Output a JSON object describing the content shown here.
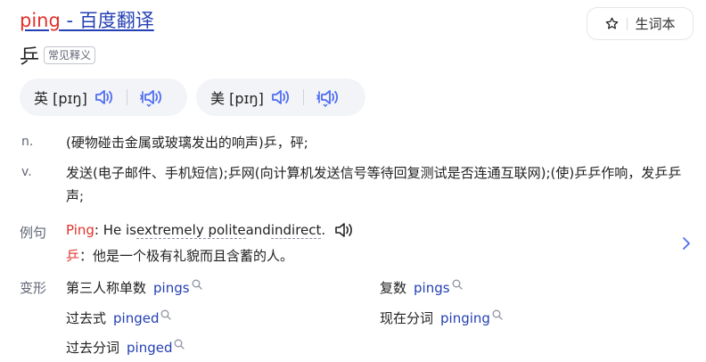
{
  "title": {
    "keyword": "ping",
    "rest": " - 百度翻译"
  },
  "vocab_button": {
    "label": "生词本"
  },
  "headword": {
    "text": "乒",
    "tag": "常见释义"
  },
  "pronunciations": [
    {
      "label": "英 [pɪŋ]"
    },
    {
      "label": "美 [pɪŋ]"
    }
  ],
  "definitions": [
    {
      "pos": "n.",
      "text": "(硬物碰击金属或玻璃发出的响声)乒，砰;"
    },
    {
      "pos": "v.",
      "text": "发送(电子邮件、手机短信);乒网(向计算机发送信号等待回复测试是否连通互联网);(使)乒乒作响，发乒乒声;"
    }
  ],
  "example": {
    "label": "例句",
    "en_keyword": "Ping",
    "en_prefix": ": He is ",
    "en_dotted": "extremely polite",
    "en_mid": " and ",
    "en_dotted2": "indirect",
    "en_suffix": ".",
    "zh_keyword": "乒",
    "zh_rest": "：他是一个极有礼貌而且含蓄的人。"
  },
  "inflections": {
    "label": "变形",
    "items": [
      {
        "name": "第三人称单数",
        "word": "pings"
      },
      {
        "name": "复数",
        "word": "pings"
      },
      {
        "name": "过去式",
        "word": "pinged"
      },
      {
        "name": "现在分词",
        "word": "pinging"
      },
      {
        "name": "过去分词",
        "word": "pinged"
      }
    ]
  },
  "icons": {
    "star": "star-icon",
    "speaker": "speaker-icon",
    "slow_speaker": "slow-speaker-icon",
    "search": "search-icon",
    "chevron": "chevron-right-icon"
  },
  "colors": {
    "keyword_red": "#e0322b",
    "link_blue": "#2440b3",
    "icon_blue": "#4e6ef2",
    "pill_bg": "#f3f4f7",
    "muted": "#626675"
  }
}
